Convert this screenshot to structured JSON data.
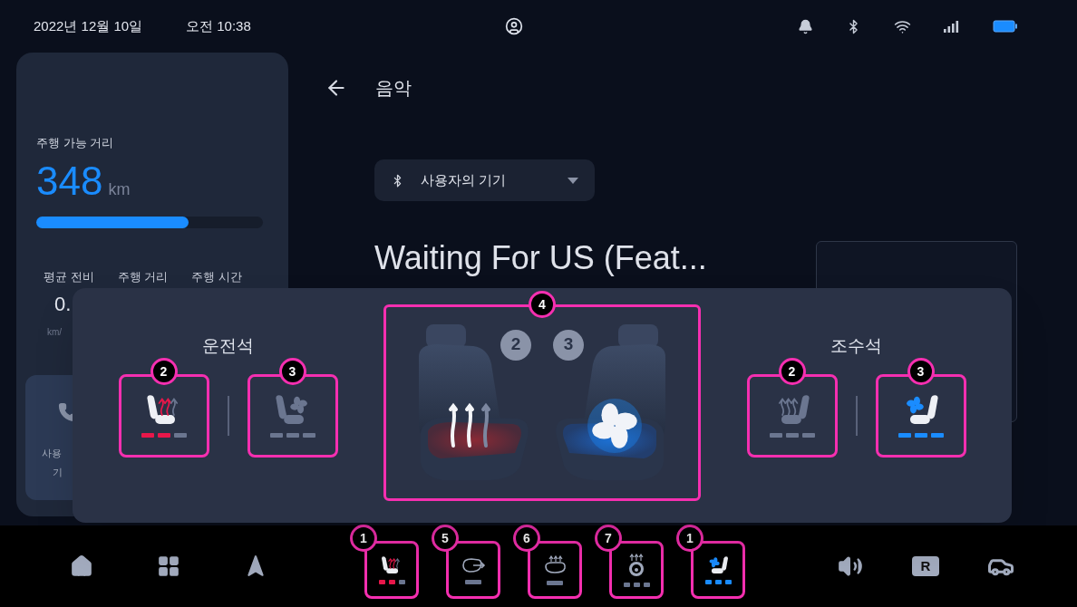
{
  "status_bar": {
    "date": "2022년 12월 10일",
    "time": "오전 10:38"
  },
  "range_card": {
    "label": "주행 가능 거리",
    "value": "348",
    "unit": "km",
    "bar": {
      "level": 0.67
    },
    "stats": [
      "평균 전비",
      "주행 거리",
      "주행 시간"
    ],
    "stat_value": "0.",
    "stat_unit": "km/",
    "phone_card": {
      "line_1": "사용",
      "line_2": "기"
    }
  },
  "music": {
    "title": "음악",
    "device": "사용자의 기기",
    "song": "Waiting For US (Feat..."
  },
  "climate_panel": {
    "driver": {
      "title": "운전석",
      "controls": [
        {
          "kind": "heat",
          "annotation": "2",
          "steps": [
            {
              "on": true
            },
            {
              "on": true
            },
            {
              "on": false
            }
          ]
        },
        {
          "kind": "vent",
          "annotation": "3",
          "steps": [
            {
              "on": false
            },
            {
              "on": false
            },
            {
              "on": false
            }
          ]
        }
      ]
    },
    "center": {
      "annotation": "4",
      "seats": [
        {
          "kind": "heat",
          "badge": "2"
        },
        {
          "kind": "vent",
          "badge": "3"
        }
      ]
    },
    "passenger": {
      "title": "조수석",
      "controls": [
        {
          "kind": "heat",
          "annotation": "2",
          "steps": [
            {
              "on": false
            },
            {
              "on": false
            },
            {
              "on": false
            }
          ]
        },
        {
          "kind": "vent",
          "annotation": "3",
          "steps": [
            {
              "on": true
            },
            {
              "on": true
            },
            {
              "on": true
            }
          ]
        }
      ]
    }
  },
  "dock": [
    {
      "kind": "home"
    },
    {
      "kind": "apps"
    },
    {
      "kind": "navigation"
    },
    {
      "kind": "seat_heat",
      "annotation": "1",
      "steps": [
        {
          "on": true
        },
        {
          "on": true
        },
        {
          "on": false
        }
      ]
    },
    {
      "kind": "mirror_heat",
      "annotation": "5",
      "steps": [
        {
          "on": false
        }
      ]
    },
    {
      "kind": "rear_defrost",
      "annotation": "6",
      "steps": [
        {
          "on": false
        }
      ]
    },
    {
      "kind": "wheel_heat",
      "annotation": "7",
      "steps": [
        {
          "on": false
        },
        {
          "on": false
        },
        {
          "on": false
        }
      ]
    },
    {
      "kind": "seat_vent",
      "annotation": "1",
      "steps": [
        {
          "on": true
        },
        {
          "on": true
        },
        {
          "on": true
        }
      ]
    },
    {
      "kind": "volume"
    },
    {
      "kind": "camera",
      "label": "R"
    },
    {
      "kind": "vehicle"
    }
  ]
}
